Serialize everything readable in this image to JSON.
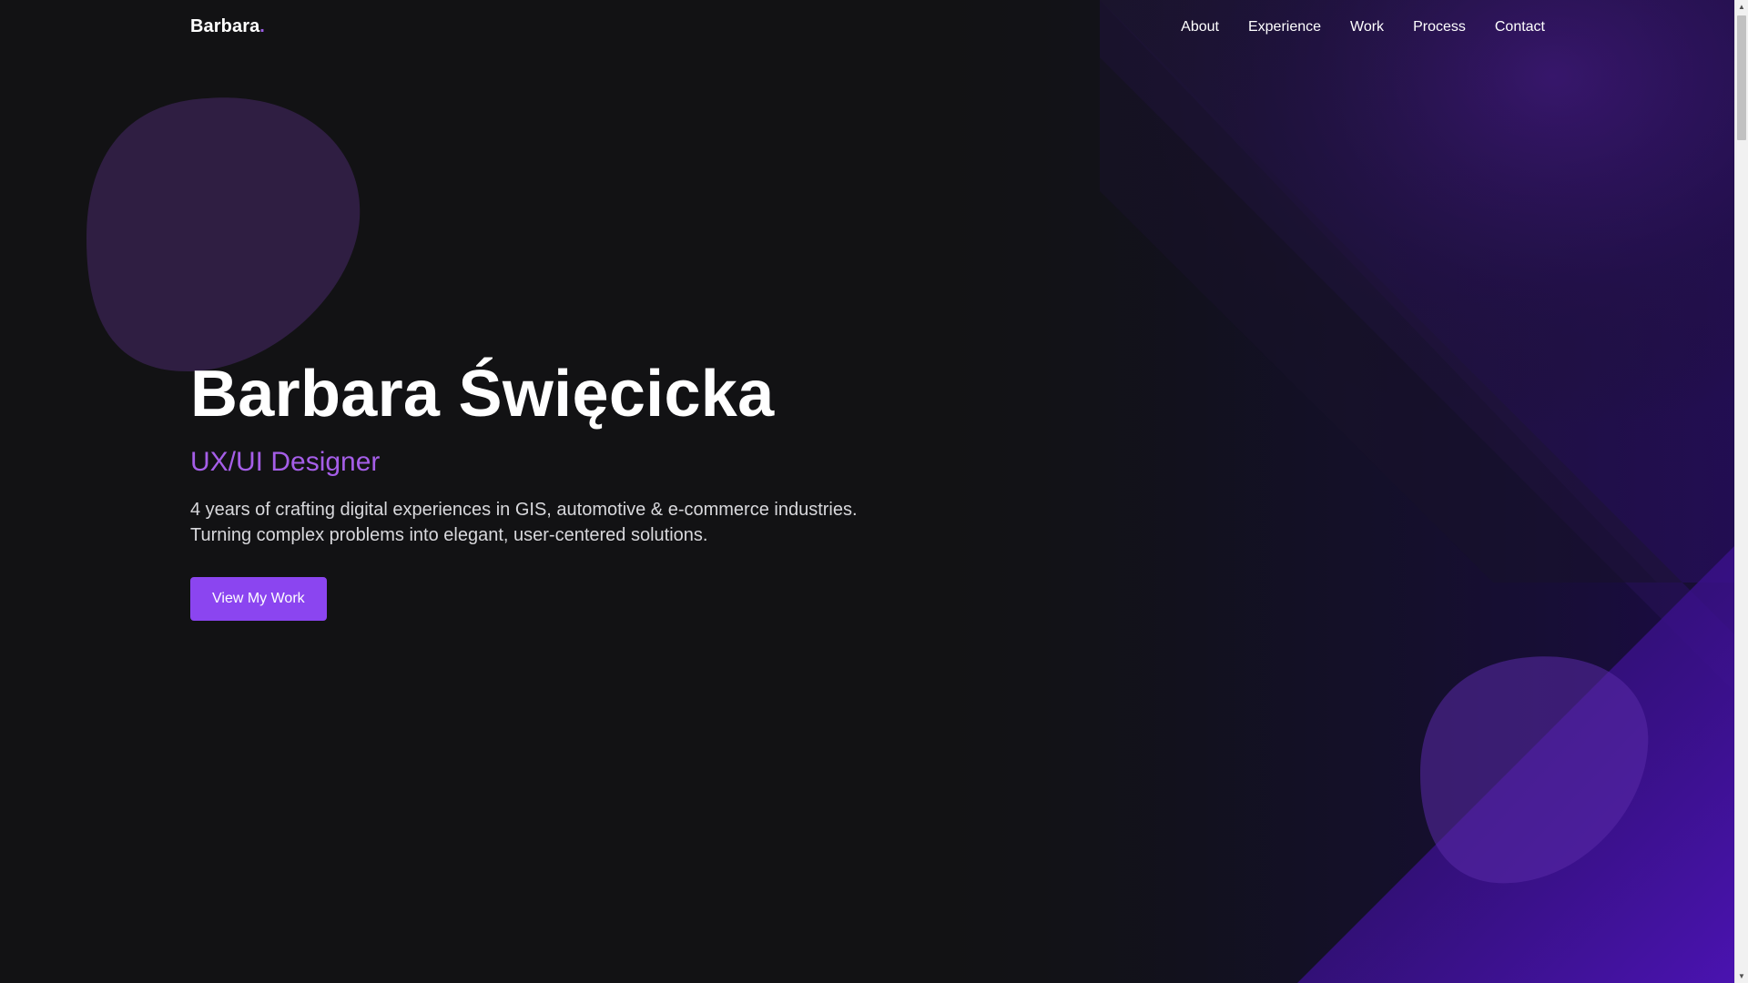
{
  "header": {
    "logo_text": "Barbara",
    "logo_dot": ".",
    "nav": [
      {
        "label": "About"
      },
      {
        "label": "Experience"
      },
      {
        "label": "Work"
      },
      {
        "label": "Process"
      },
      {
        "label": "Contact"
      }
    ]
  },
  "hero": {
    "name": "Barbara Święcicka",
    "role": "UX/UI Designer",
    "description_line1": "4 years of crafting digital experiences in GIS, automotive & e-commerce industries.",
    "description_line2": "Turning complex problems into elegant, user-centered solutions.",
    "cta_label": "View My Work"
  },
  "colors": {
    "background": "#121214",
    "accent": "#8b45f0",
    "accent_text": "#a55ee8",
    "text_primary": "#ffffff",
    "text_secondary": "#d8d8dc"
  }
}
